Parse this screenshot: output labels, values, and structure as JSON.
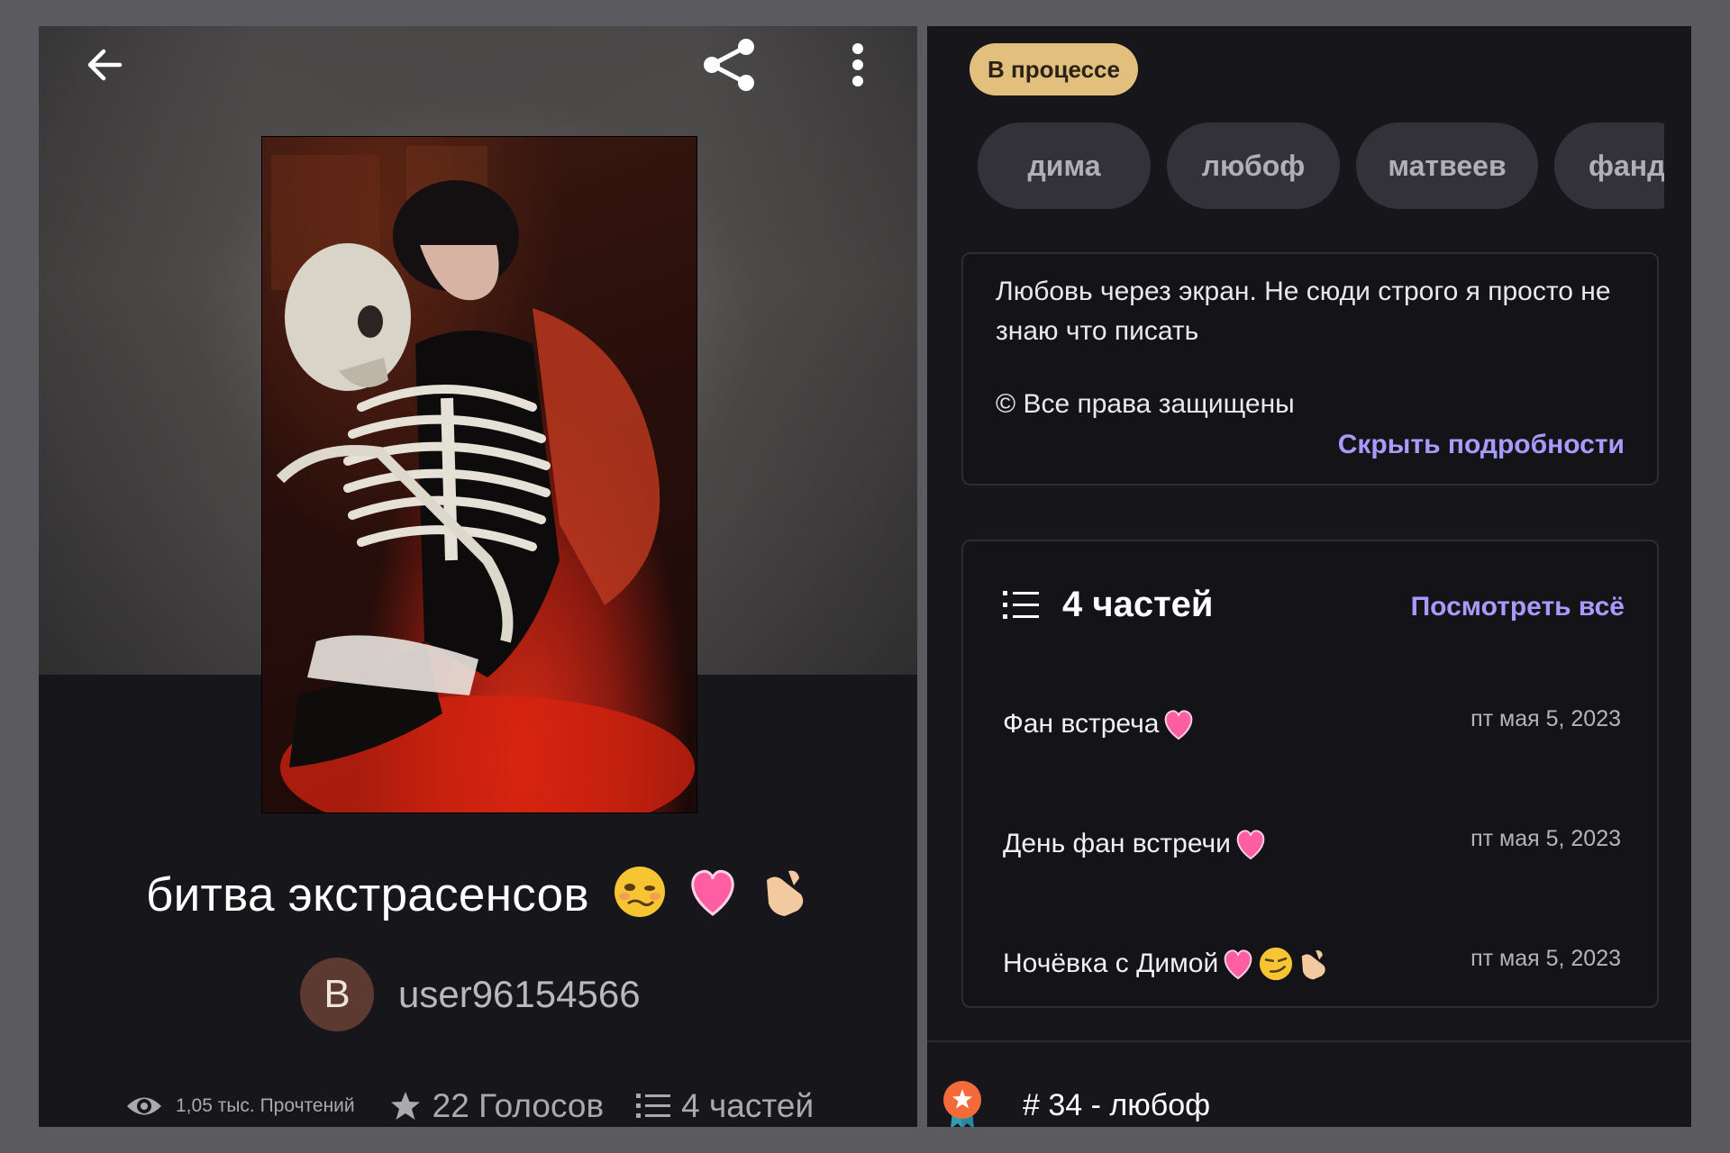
{
  "left": {
    "story_title": "битва экстрасенсов",
    "author": {
      "initial": "В",
      "name": "user96154566"
    },
    "stats": {
      "reads": "1,05 тыс. Прочтений",
      "votes": "22 Голосов",
      "parts": "4 частей"
    },
    "icons": [
      "arrow-left-icon",
      "share-icon",
      "more-vertical-icon",
      "eye-icon",
      "star-icon",
      "list-icon"
    ]
  },
  "right": {
    "status": "В процессе",
    "tags": [
      "дима",
      "любоф",
      "матвеев",
      "фанд"
    ],
    "description": "Любовь через экран. Не сюди строго я просто не знаю что писать",
    "rights": "© Все права защищены",
    "hide_details": "Скрыть подробности",
    "parts_header": {
      "title": "4 частей",
      "view_all": "Посмотреть всё"
    },
    "parts": [
      {
        "title": "Фан встреча",
        "date": "пт мая 5, 2023"
      },
      {
        "title": "День фан встречи",
        "date": "пт мая 5, 2023"
      },
      {
        "title": "Ночёвка с Димой",
        "date": "пт мая 5, 2023"
      }
    ],
    "ranking": "# 34 - любоф"
  },
  "colors": {
    "background": "#5b5a5f",
    "panel": "#17161b",
    "badge": "#e2bf7d",
    "link": "#a69bff",
    "tag_bg": "#333238"
  }
}
